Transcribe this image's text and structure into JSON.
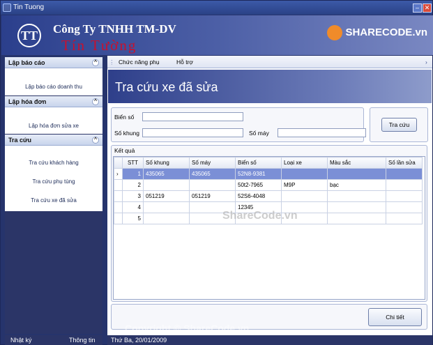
{
  "window": {
    "title": "Tin Tuong"
  },
  "watermark": {
    "logo": "SHARECODE.vn",
    "mid": "ShareCode.vn",
    "footer": "Copyright © ShareCode.vn"
  },
  "header": {
    "company_line1": "Công Ty TNHH  TM-DV",
    "company_line2": "Tín Tường",
    "logo_text": "TT"
  },
  "sidebar": {
    "groups": [
      {
        "title": "Lập báo cáo",
        "items": [
          "Lập báo cáo doanh thu"
        ]
      },
      {
        "title": "Lập hóa đơn",
        "items": [
          "Lập hóa đơn sửa xe"
        ]
      },
      {
        "title": "Tra cứu",
        "items": [
          "Tra cứu khách hàng",
          "Tra cứu phụ tùng",
          "Tra cứu xe đã sửa"
        ]
      }
    ]
  },
  "menu": {
    "items": [
      "Chức năng phụ",
      "Hỗ trợ"
    ]
  },
  "page": {
    "title": "Tra cứu xe đã sửa"
  },
  "search": {
    "bien_so_label": "Biển số",
    "so_khung_label": "Số khung",
    "so_may_label": "Số máy",
    "bien_so_value": "",
    "so_khung_value": "",
    "so_may_value": "",
    "button_label": "Tra cứu"
  },
  "results": {
    "group_label": "Kết quả",
    "columns": [
      "STT",
      "Số khung",
      "Số máy",
      "Biển số",
      "Loại xe",
      "Màu sắc",
      "Số lần sửa"
    ],
    "rows": [
      [
        "1",
        "435065",
        "435065",
        "52N8-9381",
        "",
        "",
        ""
      ],
      [
        "2",
        "",
        "",
        "50t2-7965",
        "M9P",
        "bạc",
        ""
      ],
      [
        "3",
        "051219",
        "051219",
        "52S6-4048",
        "",
        "",
        ""
      ],
      [
        "4",
        "",
        "",
        "12345",
        "",
        "",
        ""
      ],
      [
        "5",
        "",
        "",
        "",
        "",
        "",
        ""
      ]
    ]
  },
  "details_button": "Chi tiết",
  "status": {
    "left1": "Nhật ký",
    "left2": "Thông tin",
    "date": "Thứ Ba, 20/01/2009"
  },
  "colors": {
    "accent": "#2b3567",
    "selected_row": "#7b8fd6",
    "brand_red": "#c8102e"
  }
}
